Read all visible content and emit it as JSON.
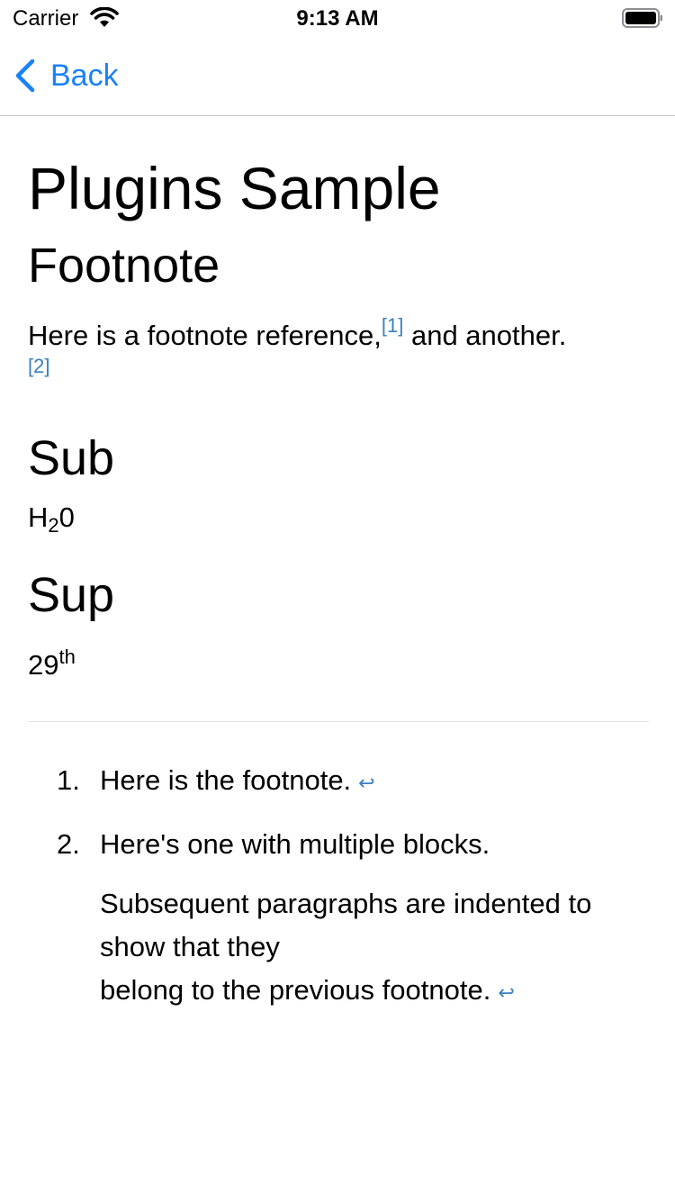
{
  "status_bar": {
    "carrier": "Carrier",
    "time": "9:13 AM"
  },
  "nav": {
    "back_label": "Back"
  },
  "article": {
    "title": "Plugins Sample",
    "footnote_section": {
      "heading": "Footnote",
      "text_before": "Here is a footnote reference,",
      "ref1": "[1]",
      "text_after": " and another.",
      "ref2": "[2]"
    },
    "sub_section": {
      "heading": "Sub",
      "base": "H",
      "subscript": "2",
      "rest": "0"
    },
    "sup_section": {
      "heading": "Sup",
      "base": "29",
      "superscript": "th"
    },
    "footnotes": [
      {
        "number": "1.",
        "paragraphs": [
          "Here is the footnote."
        ],
        "backref": "↩"
      },
      {
        "number": "2.",
        "paragraphs": [
          "Here's one with multiple blocks.",
          "Subsequent paragraphs are indented to show that they",
          "belong to the previous footnote."
        ],
        "backref": "↩"
      }
    ]
  },
  "colors": {
    "link": "#3a7fbf",
    "nav_tint": "#1a82f7",
    "separator": "#c8c8cc"
  }
}
